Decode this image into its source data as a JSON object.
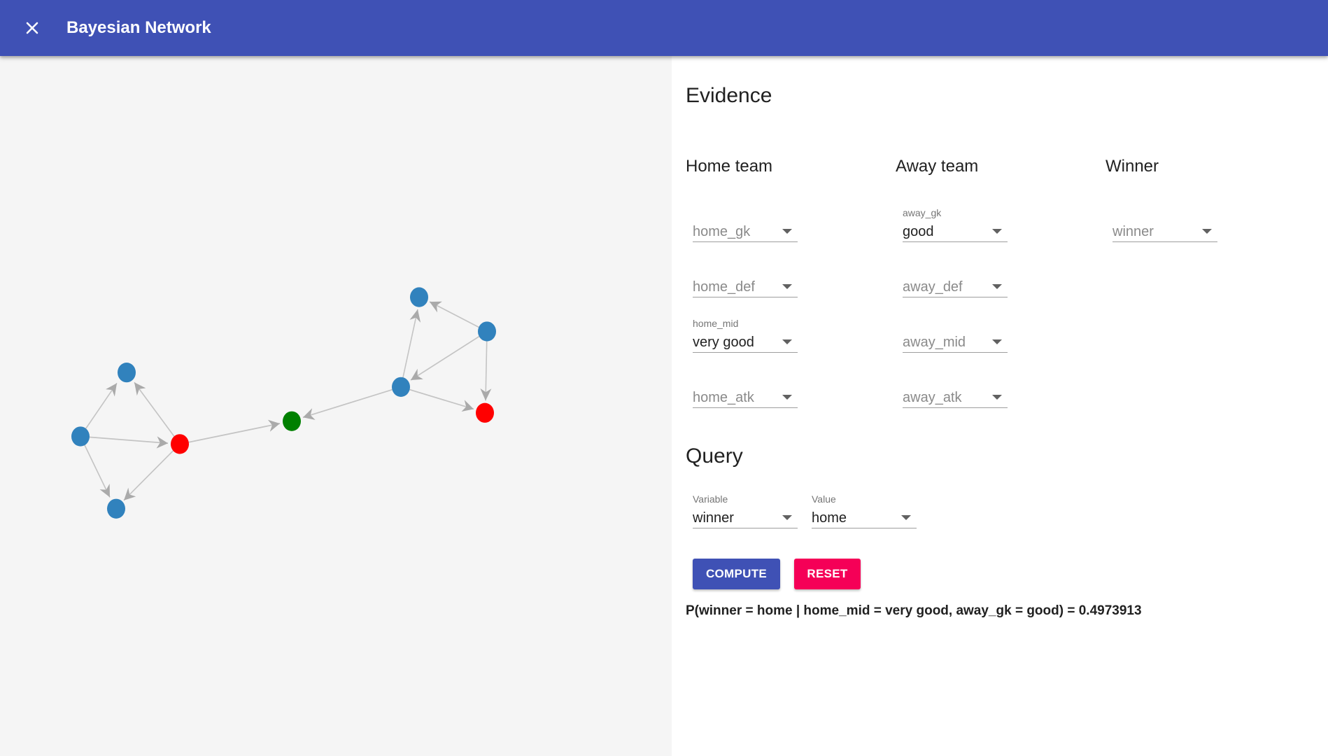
{
  "app": {
    "title": "Bayesian Network",
    "close_icon": "close-icon",
    "bar_color": "#3f51b5"
  },
  "graph": {
    "node_colors": {
      "blue": "#3182bd",
      "red": "#ff0000",
      "green": "#008000"
    },
    "edge_color": "#b0b0b0"
  },
  "evidence": {
    "title": "Evidence",
    "columns": [
      {
        "title": "Home team",
        "fields": [
          {
            "name": "home_gk",
            "label": "",
            "value": "",
            "placeholder": "home_gk"
          },
          {
            "name": "home_def",
            "label": "",
            "value": "",
            "placeholder": "home_def"
          },
          {
            "name": "home_mid",
            "label": "home_mid",
            "value": "very good",
            "placeholder": ""
          },
          {
            "name": "home_atk",
            "label": "",
            "value": "",
            "placeholder": "home_atk"
          }
        ]
      },
      {
        "title": "Away team",
        "fields": [
          {
            "name": "away_gk",
            "label": "away_gk",
            "value": "good",
            "placeholder": ""
          },
          {
            "name": "away_def",
            "label": "",
            "value": "",
            "placeholder": "away_def"
          },
          {
            "name": "away_mid",
            "label": "",
            "value": "",
            "placeholder": "away_mid"
          },
          {
            "name": "away_atk",
            "label": "",
            "value": "",
            "placeholder": "away_atk"
          }
        ]
      },
      {
        "title": "Winner",
        "fields": [
          {
            "name": "winner",
            "label": "",
            "value": "",
            "placeholder": "winner"
          }
        ]
      }
    ]
  },
  "query": {
    "title": "Query",
    "variable": {
      "label": "Variable",
      "value": "winner"
    },
    "value": {
      "label": "Value",
      "value": "home"
    },
    "compute_label": "COMPUTE",
    "reset_label": "RESET",
    "result": "P(winner = home | home_mid = very good, away_gk = good) = 0.4973913",
    "colors": {
      "compute": "#3f51b5",
      "reset": "#f50057"
    }
  }
}
